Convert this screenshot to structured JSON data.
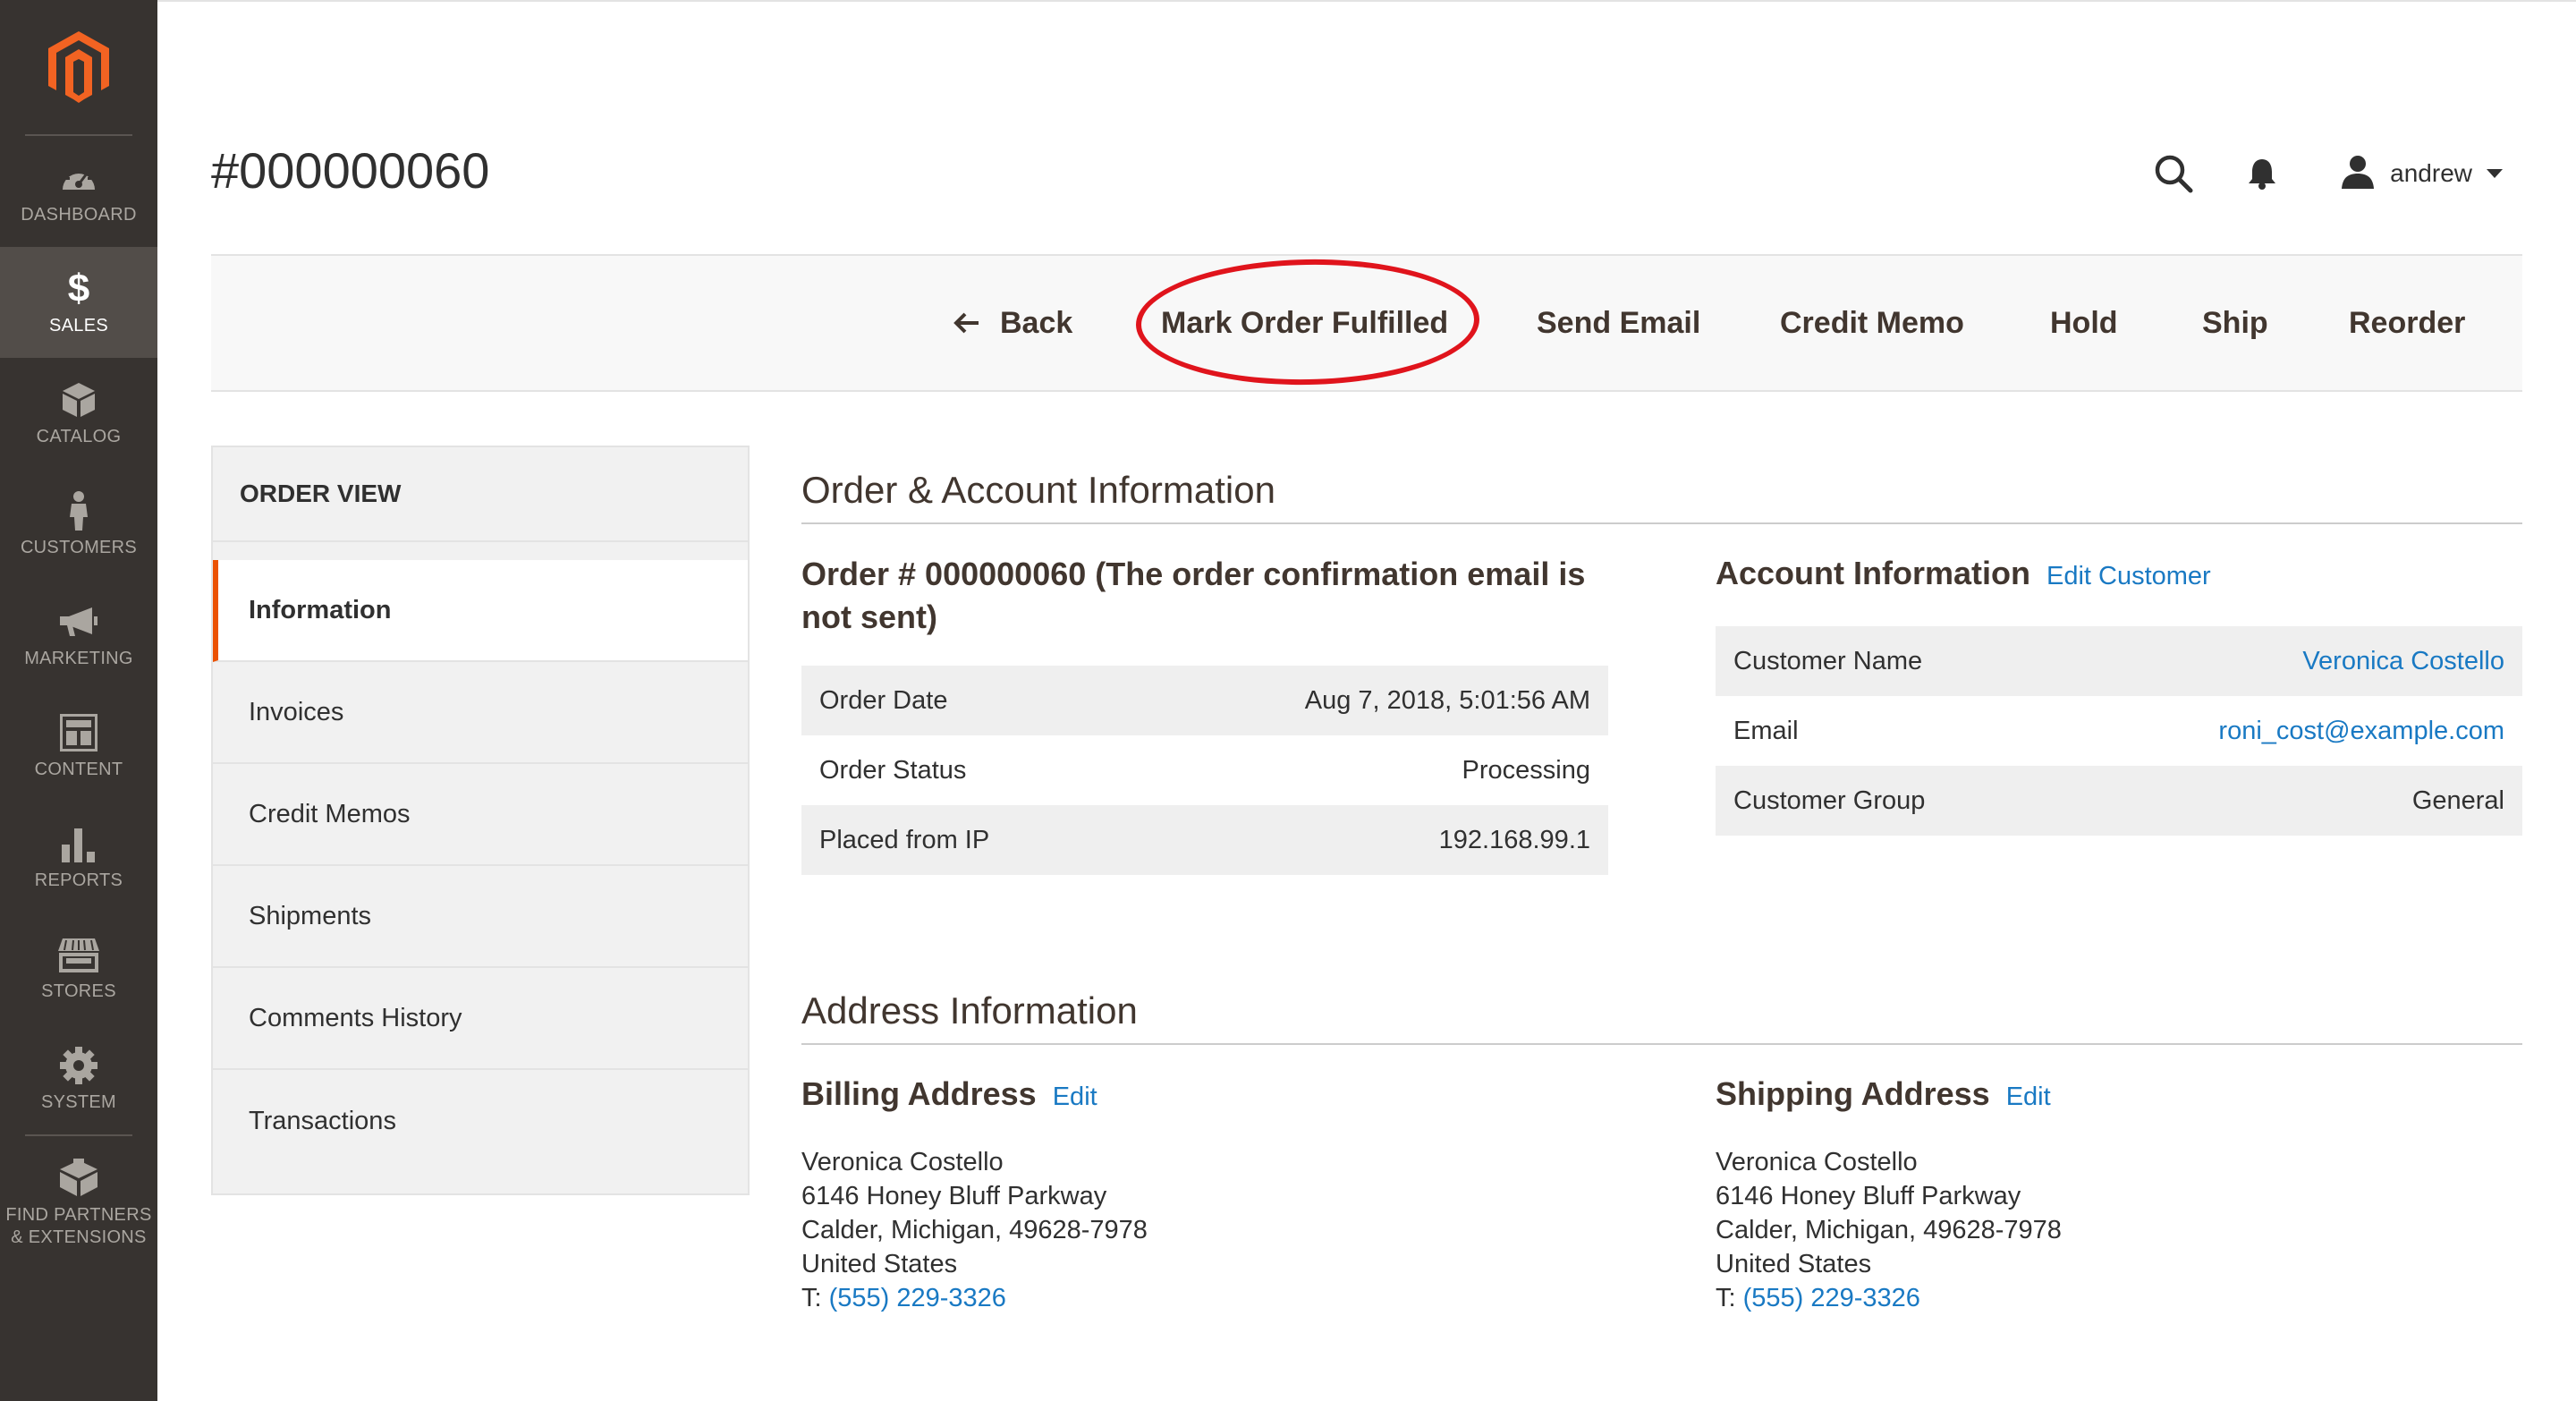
{
  "sidebar": {
    "logo": "magento-logo",
    "items": [
      {
        "label": "DASHBOARD",
        "icon": "dashboard-icon",
        "active": false
      },
      {
        "label": "SALES",
        "icon": "dollar-icon",
        "active": true
      },
      {
        "label": "CATALOG",
        "icon": "catalog-box-icon",
        "active": false
      },
      {
        "label": "CUSTOMERS",
        "icon": "customer-person-icon",
        "active": false
      },
      {
        "label": "MARKETING",
        "icon": "megaphone-icon",
        "active": false
      },
      {
        "label": "CONTENT",
        "icon": "content-layout-icon",
        "active": false
      },
      {
        "label": "REPORTS",
        "icon": "bar-chart-icon",
        "active": false
      },
      {
        "label": "STORES",
        "icon": "store-icon",
        "active": false
      },
      {
        "label": "SYSTEM",
        "icon": "gear-icon",
        "active": false
      },
      {
        "label": "FIND PARTNERS & EXTENSIONS",
        "icon": "extensions-cube-icon",
        "active": false
      }
    ]
  },
  "header": {
    "title": "#000000060",
    "user": "andrew"
  },
  "toolbar": {
    "back": "Back",
    "mark_fulfilled": "Mark Order Fulfilled",
    "send_email": "Send Email",
    "credit_memo": "Credit Memo",
    "hold": "Hold",
    "ship": "Ship",
    "reorder": "Reorder",
    "highlight_color": "#e0141c"
  },
  "tabs": {
    "title": "ORDER VIEW",
    "items": [
      "Information",
      "Invoices",
      "Credit Memos",
      "Shipments",
      "Comments History",
      "Transactions"
    ],
    "active_index": 0,
    "accent": "#eb5202"
  },
  "order_account": {
    "section_title": "Order & Account Information",
    "order_heading": "Order # 000000060 (The order confirmation email is not sent)",
    "order_rows": [
      {
        "label": "Order Date",
        "value": "Aug 7, 2018, 5:01:56 AM"
      },
      {
        "label": "Order Status",
        "value": "Processing"
      },
      {
        "label": "Placed from IP",
        "value": "192.168.99.1"
      }
    ],
    "account_heading": "Account Information",
    "edit_customer": "Edit Customer",
    "account_rows": [
      {
        "label": "Customer Name",
        "value": "Veronica Costello",
        "link": true
      },
      {
        "label": "Email",
        "value": "roni_cost@example.com",
        "link": true
      },
      {
        "label": "Customer Group",
        "value": "General",
        "link": false
      }
    ]
  },
  "address": {
    "section_title": "Address Information",
    "billing": {
      "heading": "Billing Address",
      "edit": "Edit",
      "name": "Veronica Costello",
      "street": "6146 Honey Bluff Parkway",
      "city": "Calder, Michigan, 49628-7978",
      "country": "United States",
      "phone_prefix": "T:",
      "phone": "(555) 229-3326"
    },
    "shipping": {
      "heading": "Shipping Address",
      "edit": "Edit",
      "name": "Veronica Costello",
      "street": "6146 Honey Bluff Parkway",
      "city": "Calder, Michigan, 49628-7978",
      "country": "United States",
      "phone_prefix": "T:",
      "phone": "(555) 229-3326"
    }
  },
  "colors": {
    "sidebar_bg": "#373330",
    "sidebar_active": "#524d49",
    "link": "#1979c3",
    "logo_orange": "#f26322"
  }
}
